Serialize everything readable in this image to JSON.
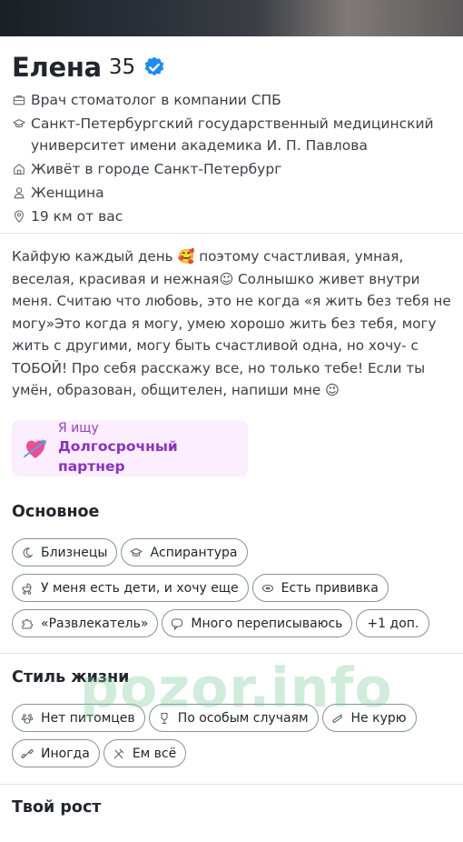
{
  "profile": {
    "name": "Елена",
    "age": "35",
    "verified_icon": "verified-badge-icon",
    "accent_color": "#1d8cf0"
  },
  "info": [
    {
      "icon": "briefcase-icon",
      "text": "Врач стоматолог в компании СПБ"
    },
    {
      "icon": "graduation-cap-icon",
      "text": "Санкт-Петербургский государственный медицинский университет имени академика И. П. Павлова"
    },
    {
      "icon": "home-icon",
      "text": "Живёт в городе Санкт-Петербург"
    },
    {
      "icon": "person-icon",
      "text": "Женщина"
    },
    {
      "icon": "location-pin-icon",
      "text": "19 км от вас"
    }
  ],
  "bio": {
    "part1": "Кайфую каждый день ",
    "emoji1": "🥰",
    "part2": " поэтому счастливая, умная, веселая, красивая и нежная☺ Солнышко живет внутри меня. Считаю что любовь, это не когда «я жить без тебя не могу»Это когда я могу, умею хорошо жить без тебя, могу жить с другими, могу быть счастливой одна, но хочу- с ТОБОЙ! Про себя расскажу все, но только тебе! Если ты умён, образован, общителен, напиши мне ",
    "emoji2": "😉"
  },
  "seeking": {
    "label": "Я ищу",
    "value": "Долгосрочный партнер",
    "icon": "heart-arrow-icon",
    "bg_color": "#fbefff",
    "text_color": "#8b2fc9"
  },
  "basics": {
    "title": "Основное",
    "chips": [
      {
        "icon": "moon-icon",
        "label": "Близнецы"
      },
      {
        "icon": "graduation-cap-icon",
        "label": "Аспирантура"
      },
      {
        "icon": "stroller-icon",
        "label": "У меня есть дети, и хочу еще"
      },
      {
        "icon": "syringe-icon",
        "label": "Есть прививка"
      },
      {
        "icon": "puzzle-icon",
        "label": "«Развлекатель»"
      },
      {
        "icon": "chat-icon",
        "label": "Много переписываюсь"
      }
    ],
    "more_label": "+1 доп."
  },
  "lifestyle": {
    "title": "Стиль жизни",
    "chips": [
      {
        "icon": "paw-icon",
        "label": "Нет питомцев"
      },
      {
        "icon": "wine-glass-icon",
        "label": "По особым случаям"
      },
      {
        "icon": "no-smoking-icon",
        "label": "Не курю"
      },
      {
        "icon": "dumbbell-icon",
        "label": "Иногда"
      },
      {
        "icon": "fork-knife-icon",
        "label": "Ем всё"
      }
    ]
  },
  "height": {
    "title": "Твой рост"
  },
  "watermark": "pozor.info"
}
